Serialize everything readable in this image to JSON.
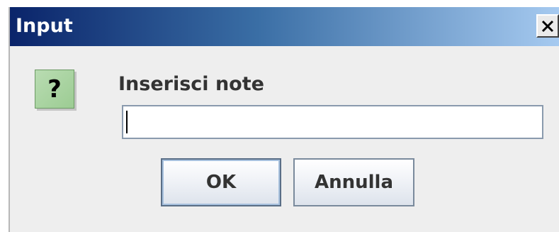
{
  "window": {
    "title": "Input",
    "close_glyph": "×"
  },
  "dialog": {
    "icon": "question-icon",
    "icon_glyph": "?",
    "prompt": "Inserisci note",
    "input_value": "",
    "input_placeholder": ""
  },
  "buttons": {
    "ok_label": "OK",
    "cancel_label": "Annulla"
  },
  "colors": {
    "titlebar_start": "#0a246a",
    "titlebar_end": "#a6caf0",
    "icon_green": "#a8d4a0",
    "dialog_bg": "#eeeeee"
  }
}
